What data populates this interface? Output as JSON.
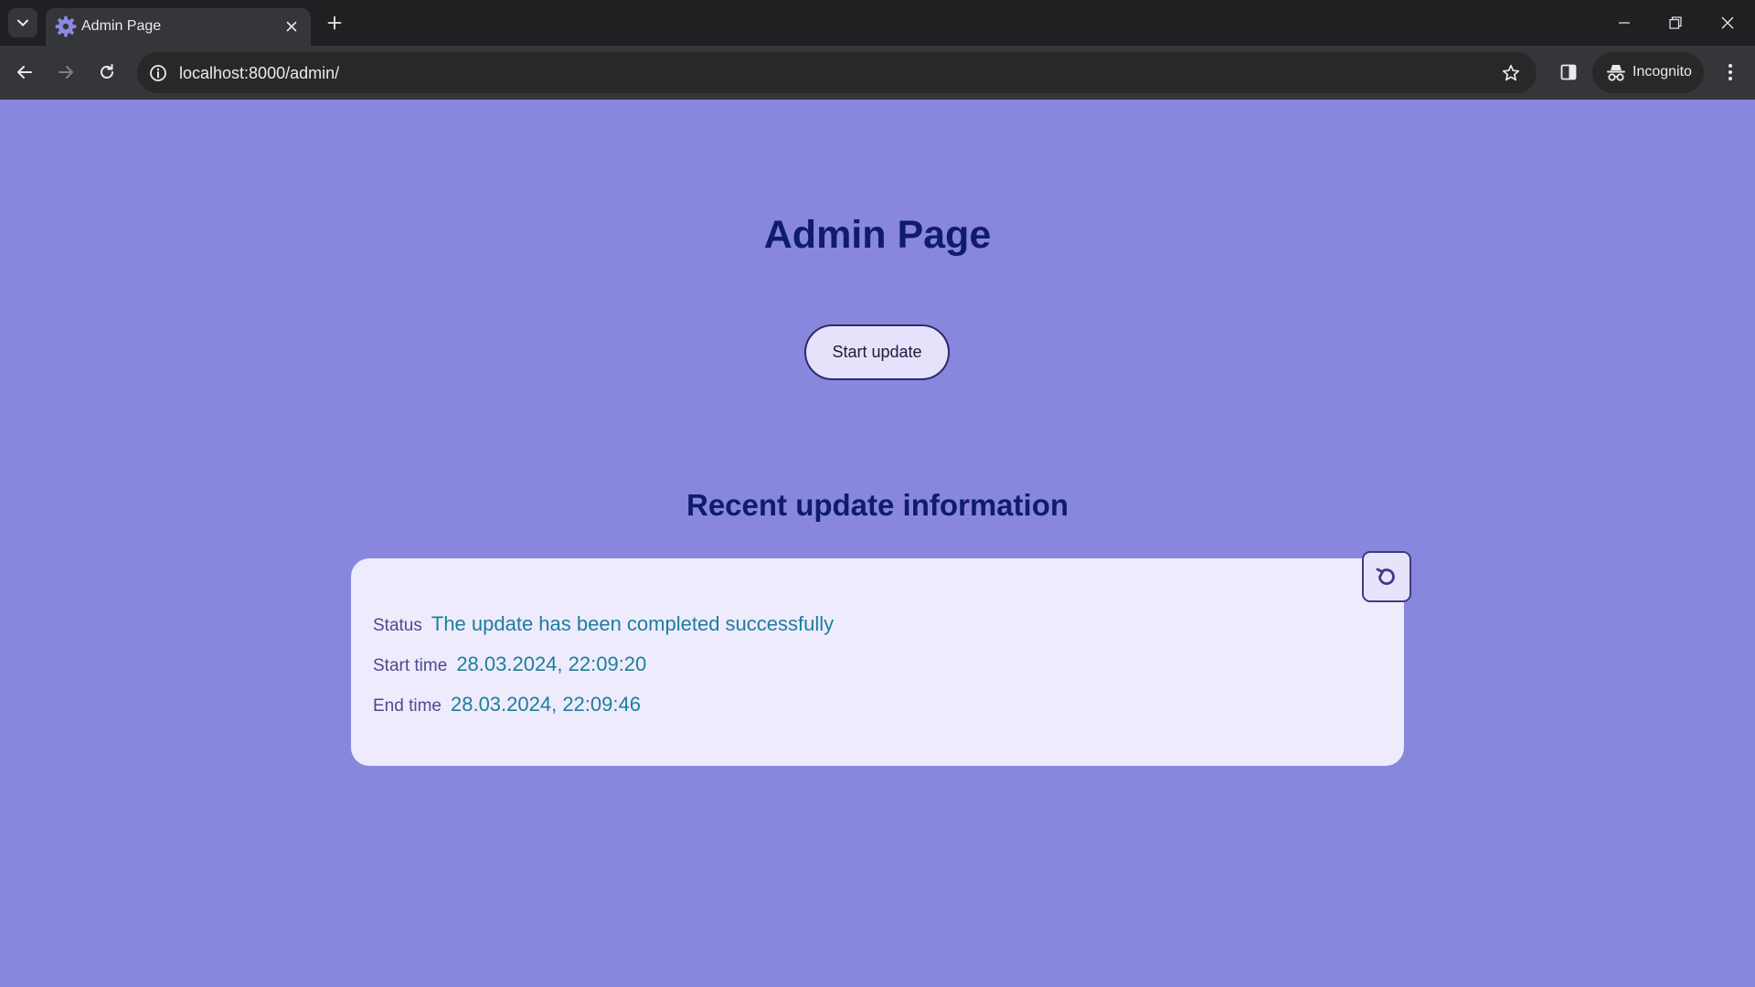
{
  "browser": {
    "tab_title": "Admin Page",
    "url": "localhost:8000/admin/",
    "incognito_label": "Incognito"
  },
  "page": {
    "title": "Admin Page",
    "start_button_label": "Start update",
    "section_title": "Recent update information",
    "info": {
      "status_label": "Status",
      "status_value": "The update has been completed successfully",
      "start_label": "Start time",
      "start_value": "28.03.2024, 22:09:20",
      "end_label": "End time",
      "end_value": "28.03.2024, 22:09:46"
    }
  },
  "colors": {
    "page_background": "#8887dd",
    "heading": "#0f1c6b",
    "value_text": "#1d7e9c",
    "card_background": "#eeebfc"
  },
  "icons": [
    "chevron-down-icon",
    "gear-icon",
    "close-icon",
    "plus-icon",
    "minimize-icon",
    "restore-icon",
    "back-arrow-icon",
    "forward-arrow-icon",
    "reload-icon",
    "info-icon",
    "star-icon",
    "side-panel-icon",
    "incognito-icon",
    "kebab-menu-icon",
    "refresh-icon"
  ]
}
